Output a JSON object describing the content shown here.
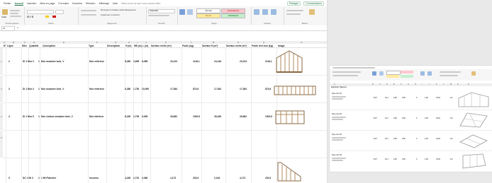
{
  "main": {
    "menu": [
      "Fichier",
      "Accueil",
      "Insertion",
      "Mise en page",
      "Formules",
      "Données",
      "Révision",
      "Affichage",
      "Aide"
    ],
    "menu_active_index": 1,
    "tell_me": "Dites-nous ce que vous voulez faire",
    "share_label": "Partager",
    "comments_label": "Commentaires",
    "ribbon": {
      "clipboard_label": "Presse-papiers",
      "paste": "Coller",
      "font_label": "Police",
      "alignment_label": "Alignement",
      "number_label": "Nombre",
      "styles_label": "Styles",
      "style_normal": "Normal",
      "style_bad": "Insatisfaisant",
      "style_neutral": "Neutre",
      "style_good": "Satisfaisant",
      "cells_label": "Cellules",
      "editing_label": "Édition",
      "wrap_text": "Renvoyer à la ligne automatiquement",
      "merge_center": "Fusionner et centrer",
      "format_standard": "Standard"
    },
    "formula_bar": {
      "name_box": "A1",
      "fx": "fx"
    },
    "columns": [
      "A",
      "B",
      "C",
      "D",
      "E",
      "F",
      "G",
      "H",
      "I",
      "J",
      "K",
      "L",
      "M",
      "N",
      "O",
      "P"
    ],
    "headers": [
      "N°",
      "Ligne",
      "Mire",
      "Quantité",
      "Conception",
      "Type",
      "Description",
      "H (m)",
      "HB (m)",
      "L (m)",
      "Surface réelle (m²)",
      "Poids (kg)",
      "Surface ff (m²)",
      "Surface réelle (m²)",
      "Poids réel mur (kg)",
      "Image"
    ],
    "rows": [
      {
        "num": "2",
        "n": "2",
        "ligne": "Di 1 Mur 3",
        "qty": "1",
        "conc": "Mur ossature bois_V",
        "type": "Mur extérieur",
        "h": "8,280",
        "hb": "2,895",
        "l": "8,085",
        "surf": "23,313",
        "poids": "1118,1",
        "sff": "24,146",
        "sr": "23,313",
        "pr": "1118,1"
      },
      {
        "num": "3",
        "n": "3",
        "ligne": "Di 1 Mur 4",
        "qty": "1",
        "conc": "Mur ossature bois_V",
        "type": "Mur extérieur",
        "h": "6,280",
        "hb": "1,730",
        "l": "10,090",
        "surf": "17,384",
        "poids": "874,6",
        "sff": "17,454",
        "sr": "17,384",
        "pr": "874,6"
      },
      {
        "num": "4",
        "n": "4",
        "ligne": "Di 1 Mur 5",
        "qty": "1",
        "conc": "Mur cloison ossature bois_V",
        "type": "Mur intérieur",
        "h": "8,180",
        "hb": "2,739",
        "l": "9,935",
        "surf": "26,682",
        "poids": "1000,5",
        "sff": "26,435",
        "sr": "26,682",
        "pr": "1000,5"
      },
      {
        "num": "5",
        "n": "5",
        "ligne": "DC 1 Mi 3",
        "qty": "1",
        "conc": "1 Mi Plancher",
        "type": "Inconnu",
        "h": "4,180",
        "hb": "2,710",
        "l": "2,066",
        "surf": "4,172",
        "poids": "202,5",
        "sff": "2,164",
        "sr": "4,172",
        "pr": "202,5"
      }
    ]
  },
  "side": {
    "columns": [
      "A",
      "B",
      "C",
      "D",
      "E",
      "F",
      "G",
      "H",
      "I",
      "J",
      "K",
      "L",
      "M",
      "N",
      "O"
    ],
    "header_label": "Imprimer l'aperçu",
    "rows": [
      {
        "desc": "Type mur 01",
        "vals": [
          "8,07",
          "10,1",
          "0,00",
          "0,00",
          "0",
          "1,00",
          "0,011",
          "0,0"
        ]
      },
      {
        "desc": "Type mur 02",
        "vals": [
          "8,07",
          "10,1",
          "0,00",
          "0,00",
          "0",
          "1,00",
          "0,011",
          "0,0"
        ]
      },
      {
        "desc": "Type mur 03",
        "vals": [
          "8,07",
          "10,1",
          "0,00",
          "0,00",
          "0",
          "1,00",
          "0,011",
          "0,0"
        ]
      },
      {
        "desc": "Type mur 04",
        "vals": [
          "8,07",
          "10,1",
          "0,00",
          "0,00",
          "0",
          "1,00",
          "0,011",
          "0,0"
        ]
      }
    ]
  },
  "colors": {
    "accent": "#217346",
    "bad": "#ffc7ce",
    "neutral": "#ffeb9c",
    "good": "#c6efce"
  }
}
